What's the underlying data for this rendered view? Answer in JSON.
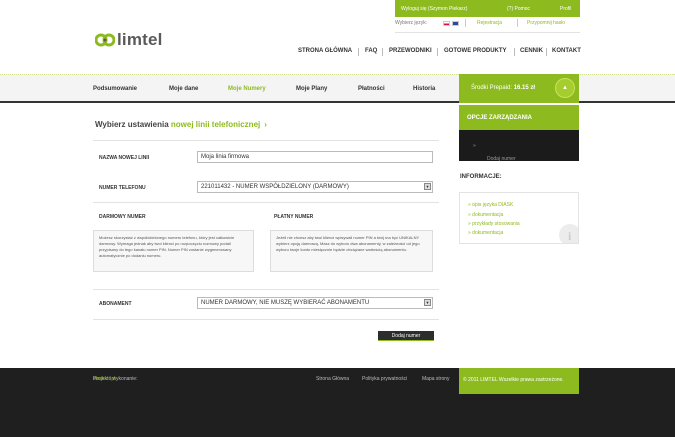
{
  "topbar": {
    "user": "Wyloguj się (Szymon Piekarz)",
    "help": "(?) Pomoc",
    "profile": "Profil",
    "language_label": "Wybierz język:",
    "register": "Rejestracja",
    "password_reminder": "Przypomnij hasło"
  },
  "logo": {
    "text": "limtel"
  },
  "main_nav": [
    "STRONA GŁÓWNA",
    "FAQ",
    "PRZEWODNIKI",
    "GOTOWE PRODUKTY",
    "CENNIK",
    "KONTAKT"
  ],
  "tabs": [
    {
      "label": "Podsumowanie",
      "active": false
    },
    {
      "label": "Moje dane",
      "active": false
    },
    {
      "label": "Moje Numery",
      "active": true
    },
    {
      "label": "Moje Plany",
      "active": false
    },
    {
      "label": "Płatności",
      "active": false
    },
    {
      "label": "Historia",
      "active": false
    }
  ],
  "prepaid": {
    "label": "Środki Prepaid:",
    "amount": "16.15 zł"
  },
  "form": {
    "heading_prefix": "Wybierz ustawienia",
    "heading_highlight": "nowej linii telefonicznej",
    "line_name_label": "NAZWA NOWEJ LINII",
    "line_name_value": "Moja linia firmowa",
    "phone_label": "NUMER TELEFONU",
    "phone_value": "221011432 - NUMER WSPÓŁDZIELONY (DARMOWY)",
    "free_title": "DARMOWY NUMER",
    "free_text": "Możesz skorzystać z współdzielonego numeru telefonu, który jest całkowicie darmowy. Wymaga jednak aby twoi klienci po rozpoczęciu rozmowy podali przypisany do tego kanału numer PIN. Numer PIN zostanie wygenerowany automatycznie po dodaniu numeru.",
    "paid_title": "PŁATNY NUMER",
    "paid_text": "Jeżeli nie chcesz aby twoi klienci wpisywali numer PIN a twój ma być UNIKALNY wybierz opcję darmową. Masz do wyboru dwa abonamenty, w zależności od jego wyboru twoje konto miesięcznie będzie obciążane wartością abonamentu.",
    "subscription_label": "ABONAMENT",
    "subscription_value": "NUMER DARMOWY, NIE MUSZĘ WYBIERAĆ ABONAMENTU",
    "submit_label": "Dodaj numer"
  },
  "sidebar": {
    "heading": "OPCJE ZARZĄDZANIA",
    "add_number": "Dodaj numer",
    "info_title": "INFORMACJE:",
    "info_links": [
      "opis języka DIASK",
      "dokumentacja",
      "przykłady stosowania",
      "dokumentacja"
    ]
  },
  "footer": {
    "credits_prefix": "Projekt i wykonanie:",
    "credits_link": "blacklot.pl",
    "links": [
      "Strona Główna",
      "Polityka prywatności",
      "Mapa strony"
    ],
    "copyright": "© 2011 LIMTEL Wszelkie prawa zastrzeżone."
  },
  "colors": {
    "accent": "#8dbb1f",
    "dark": "#1f1f1f"
  }
}
